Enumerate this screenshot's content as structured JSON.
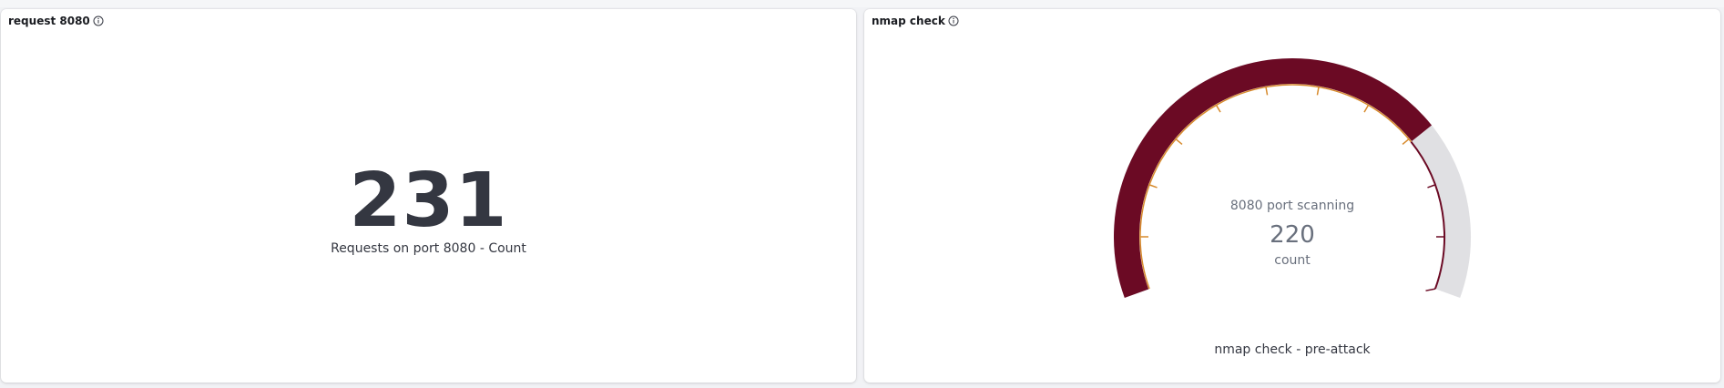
{
  "panels": {
    "left": {
      "title": "request 8080",
      "metric_value": "231",
      "metric_label": "Requests on port 8080 - Count"
    },
    "right": {
      "title": "nmap check",
      "subtitle": "8080 port scanning",
      "value": "220",
      "unit": "count",
      "caption": "nmap check - pre-attack"
    }
  },
  "gauge": {
    "min": 0,
    "max": 300,
    "value": 220,
    "sweep_degrees": 220,
    "fill_color": "#6b0a24",
    "track_color": "#e0e0e3",
    "tick_colors": [
      "#d78a2c",
      "#6b0a24"
    ]
  },
  "icons": {
    "info": "info-circle-icon"
  }
}
